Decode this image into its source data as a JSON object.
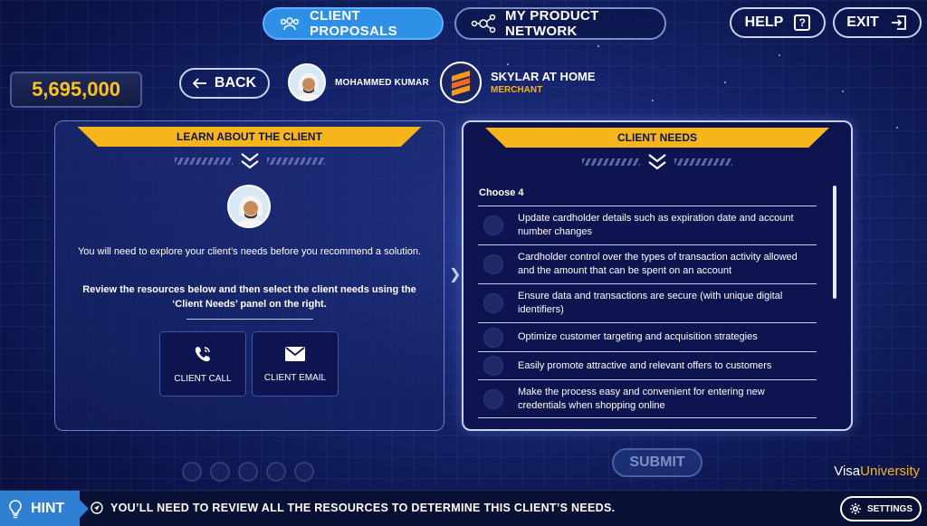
{
  "topnav": {
    "client_proposals": "CLIENT PROPOSALS",
    "product_network": "MY PRODUCT NETWORK",
    "help": "HELP",
    "exit": "EXIT"
  },
  "score": "5,695,000",
  "back": "BACK",
  "client": {
    "name": "MOHAMMED KUMAR"
  },
  "merchant": {
    "name": "SKYLAR AT HOME",
    "type": "MERCHANT"
  },
  "left_panel": {
    "title": "LEARN ABOUT THE CLIENT",
    "intro": "You will need to explore your client’s needs before you recommend a solution.",
    "instruction": "Review the resources below and then select the client needs using the ‘Client Needs’ panel on the right.",
    "resources": [
      {
        "label": "CLIENT CALL",
        "icon": "phone-icon"
      },
      {
        "label": "CLIENT EMAIL",
        "icon": "mail-icon"
      }
    ]
  },
  "right_panel": {
    "title": "CLIENT NEEDS",
    "choose": "Choose 4",
    "needs": [
      "Update cardholder details such as expiration date and account number changes",
      "Cardholder control over the types of transaction activity allowed and the amount that can be spent on an account",
      "Ensure data and transactions are secure (with unique digital identifiers)",
      "Optimize customer targeting and acquisition strategies",
      "Easily promote attractive and relevant offers to customers",
      "Make the process easy and convenient for entering new credentials when shopping online"
    ]
  },
  "submit": "SUBMIT",
  "brand": {
    "part1": "Visa",
    "part2": "University"
  },
  "hint": {
    "label": "HINT",
    "message": "YOU’LL NEED TO REVIEW ALL THE RESOURCES TO DETERMINE THIS CLIENT’S NEEDS."
  },
  "settings": "SETTINGS",
  "colors": {
    "accent": "#f5b51b",
    "active_tab": "#2e8fe6",
    "score": "#ffc21a"
  }
}
